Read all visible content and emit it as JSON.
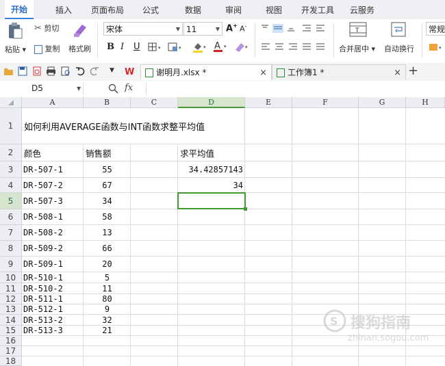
{
  "menu": {
    "tabs": [
      "开始",
      "插入",
      "页面布局",
      "公式",
      "数据",
      "审阅",
      "视图",
      "开发工具",
      "云服务"
    ]
  },
  "ribbon": {
    "paste": "粘贴",
    "cut": "剪切",
    "copy": "复制",
    "format_painter": "格式刷",
    "font_name": "宋体",
    "font_size": "11",
    "bold": "B",
    "italic": "I",
    "underline": "U",
    "merge_center": "合并居中",
    "wrap_text": "自动换行",
    "number_format": "常规",
    "font_color": "#e02020",
    "fill_color": "#f7d22a"
  },
  "doc_tabs": [
    {
      "name": "谢明月.xlsx *"
    },
    {
      "name": "工作簿1 *"
    }
  ],
  "formula_bar": {
    "name_box": "D5",
    "fx": "fx",
    "formula": ""
  },
  "sheet": {
    "columns": [
      "A",
      "B",
      "C",
      "D",
      "E",
      "F",
      "G",
      "H"
    ],
    "selected_column": "D",
    "selected_row": "5",
    "row_numbers": [
      "1",
      "2",
      "3",
      "4",
      "5",
      "6",
      "7",
      "8",
      "9",
      "10",
      "11",
      "12",
      "13",
      "14",
      "15",
      "16",
      "17",
      "18"
    ],
    "title": "如何利用AVERAGE函数与INT函数求整平均值",
    "header_a": "颜色",
    "header_b": "销售额",
    "header_d": "求平均值",
    "rows": [
      {
        "a": "DR-507-1",
        "b": "55"
      },
      {
        "a": "DR-507-2",
        "b": "67"
      },
      {
        "a": "DR-507-3",
        "b": "34"
      },
      {
        "a": "DR-508-1",
        "b": "58"
      },
      {
        "a": "DR-508-2",
        "b": "13"
      },
      {
        "a": "DR-509-2",
        "b": "66"
      },
      {
        "a": "DR-509-1",
        "b": "20"
      },
      {
        "a": "DR-510-1",
        "b": "5"
      },
      {
        "a": "DR-510-2",
        "b": "11"
      },
      {
        "a": "DR-511-1",
        "b": "80"
      },
      {
        "a": "DR-512-1",
        "b": "9"
      },
      {
        "a": "DR-513-2",
        "b": "32"
      },
      {
        "a": "DR-513-3",
        "b": "21"
      }
    ],
    "d3": "34.42857143",
    "d4": "34"
  },
  "watermark": {
    "main": "搜狗指南",
    "sub": "zhinan.sogou.com"
  }
}
